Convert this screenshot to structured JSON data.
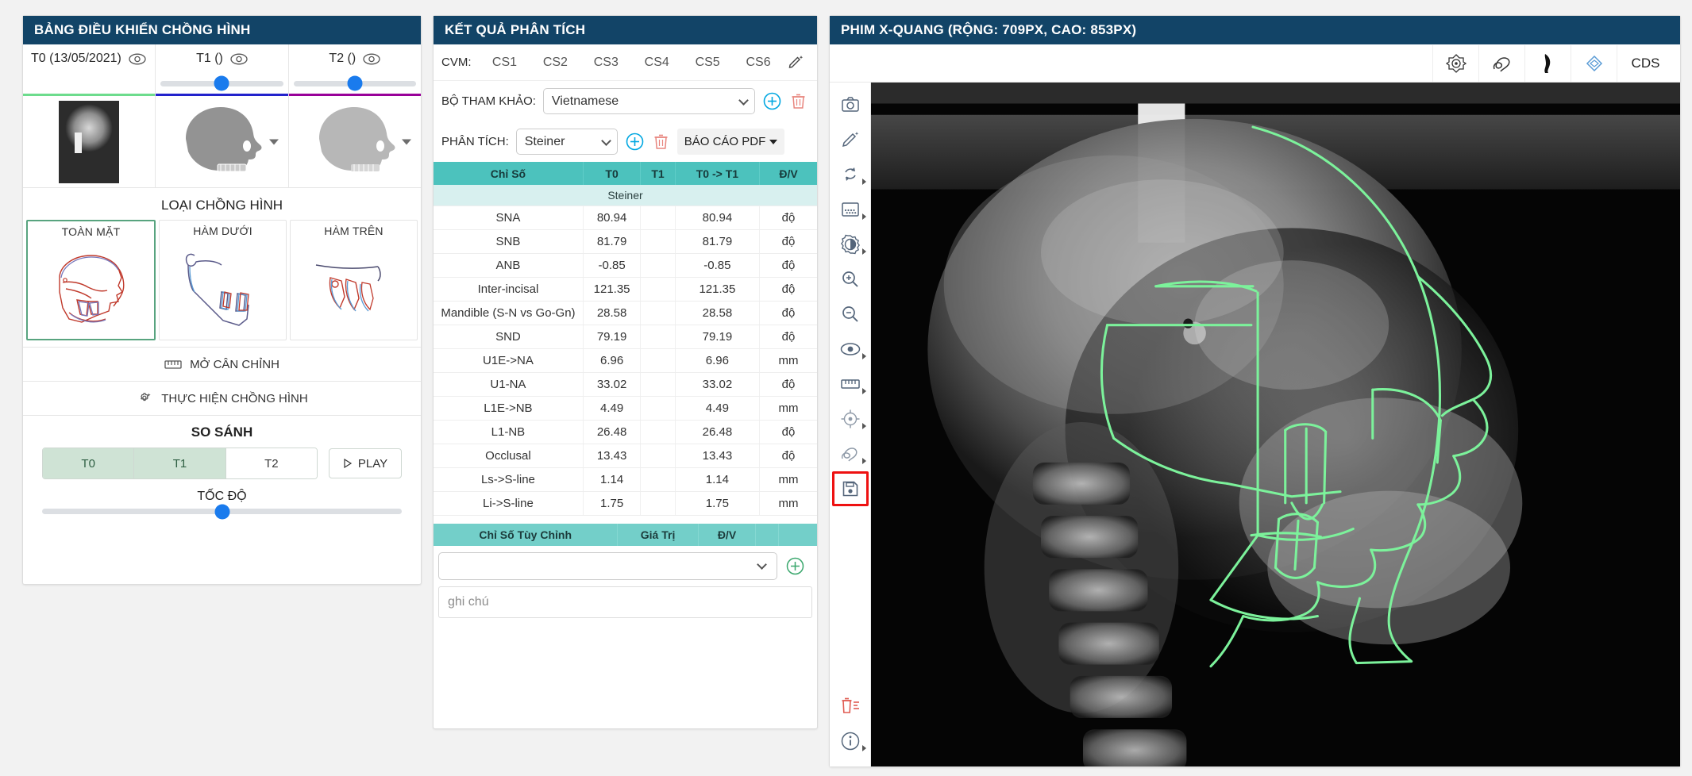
{
  "left_panel": {
    "title": "BẢNG ĐIỀU KHIỂN CHỒNG HÌNH",
    "timepoints": [
      {
        "label": "T0 (13/05/2021)",
        "accent": "#6ddc8d",
        "has_slider": false,
        "slider_pct": 0
      },
      {
        "label": "T1 ()",
        "accent": "#2222cc",
        "has_slider": true,
        "slider_pct": 50
      },
      {
        "label": "T2 ()",
        "accent": "#990099",
        "has_slider": true,
        "slider_pct": 50
      }
    ],
    "overlay_type_label": "LOẠI CHỒNG HÌNH",
    "overlay_types": [
      {
        "label": "TOÀN MẶT",
        "selected": true
      },
      {
        "label": "HÀM DƯỚI",
        "selected": false
      },
      {
        "label": "HÀM TRÊN",
        "selected": false
      }
    ],
    "open_calibration": "MỞ CÂN CHỈNH",
    "run_superimposition": "THỰC HIỆN CHỒNG HÌNH",
    "compare_title": "SO SÁNH",
    "compare_buttons": [
      {
        "label": "T0",
        "active": true
      },
      {
        "label": "T1",
        "active": true
      },
      {
        "label": "T2",
        "active": false
      }
    ],
    "play_label": "PLAY",
    "speed_label": "TỐC ĐỘ",
    "speed_pct": 50
  },
  "mid_panel": {
    "title": "KẾT QUẢ PHÂN TÍCH",
    "cvm_label": "CVM:",
    "cvm_stages": [
      "CS1",
      "CS2",
      "CS3",
      "CS4",
      "CS5",
      "CS6"
    ],
    "reference_label": "BỘ THAM KHẢO:",
    "reference_value": "Vietnamese",
    "analysis_label": "PHÂN TÍCH:",
    "analysis_value": "Steiner",
    "pdf_button": "BÁO CÁO PDF",
    "table": {
      "headers": [
        "Chỉ Số",
        "T0",
        "T1",
        "T0 -> T1",
        "Đ/V"
      ],
      "group_label": "Steiner",
      "rows": [
        {
          "name": "SNA",
          "t0": "80.94",
          "t0_color": "blue",
          "t1": "",
          "delta": "80.94",
          "unit": "độ"
        },
        {
          "name": "SNB",
          "t0": "81.79",
          "t0_color": "normal",
          "t1": "",
          "delta": "81.79",
          "unit": "độ"
        },
        {
          "name": "ANB",
          "t0": "-0.85",
          "t0_color": "blue",
          "t1": "",
          "delta": "-0.85",
          "unit": "độ"
        },
        {
          "name": "Inter-incisal",
          "t0": "121.35",
          "t0_color": "normal",
          "t1": "",
          "delta": "121.35",
          "unit": "độ"
        },
        {
          "name": "Mandible (S-N vs Go-Gn)",
          "t0": "28.58",
          "t0_color": "normal",
          "t1": "",
          "delta": "28.58",
          "unit": "độ"
        },
        {
          "name": "SND",
          "t0": "79.19",
          "t0_color": "normal",
          "t1": "",
          "delta": "79.19",
          "unit": "độ"
        },
        {
          "name": "U1E->NA",
          "t0": "6.96",
          "t0_color": "red",
          "t1": "",
          "delta": "6.96",
          "unit": "mm"
        },
        {
          "name": "U1-NA",
          "t0": "33.02",
          "t0_color": "red",
          "t1": "",
          "delta": "33.02",
          "unit": "độ"
        },
        {
          "name": "L1E->NB",
          "t0": "4.49",
          "t0_color": "normal",
          "t1": "",
          "delta": "4.49",
          "unit": "mm"
        },
        {
          "name": "L1-NB",
          "t0": "26.48",
          "t0_color": "normal",
          "t1": "",
          "delta": "26.48",
          "unit": "độ"
        },
        {
          "name": "Occlusal",
          "t0": "13.43",
          "t0_color": "normal",
          "t1": "",
          "delta": "13.43",
          "unit": "độ"
        },
        {
          "name": "Ls->S-line",
          "t0": "1.14",
          "t0_color": "normal",
          "t1": "",
          "delta": "1.14",
          "unit": "mm"
        },
        {
          "name": "Li->S-line",
          "t0": "1.75",
          "t0_color": "normal",
          "t1": "",
          "delta": "1.75",
          "unit": "mm"
        }
      ]
    },
    "custom_table": {
      "headers": [
        "Chỉ Số Tùy Chỉnh",
        "Giá Trị",
        "Đ/V",
        "",
        ""
      ],
      "select_value": ""
    },
    "note_placeholder": "ghi chú"
  },
  "right_panel": {
    "title": "PHIM X-QUANG (RỘNG: 709PX, CAO: 853PX)",
    "top_tools": [
      {
        "name": "target-icon",
        "label": ""
      },
      {
        "name": "curve-trace-icon",
        "label": ""
      },
      {
        "name": "profile-shape-icon",
        "label": ""
      },
      {
        "name": "layers-icon",
        "label": ""
      },
      {
        "name": "cds-label",
        "label": "CDS"
      }
    ],
    "side_tools": [
      {
        "name": "camera-icon",
        "caret": false,
        "selected": false,
        "danger": false
      },
      {
        "name": "pencil-add-icon",
        "caret": false,
        "selected": false,
        "danger": false
      },
      {
        "name": "rotate-icon",
        "caret": true,
        "selected": false,
        "danger": false
      },
      {
        "name": "filter-grid-icon",
        "caret": true,
        "selected": false,
        "danger": false
      },
      {
        "name": "brightness-contrast-icon",
        "caret": true,
        "selected": false,
        "danger": false
      },
      {
        "name": "zoom-in-icon",
        "caret": false,
        "selected": false,
        "danger": false
      },
      {
        "name": "zoom-out-icon",
        "caret": false,
        "selected": false,
        "danger": false
      },
      {
        "name": "eye-icon",
        "caret": true,
        "selected": false,
        "danger": false
      },
      {
        "name": "ruler-icon",
        "caret": true,
        "selected": false,
        "danger": false
      },
      {
        "name": "crosshair-icon",
        "caret": true,
        "selected": false,
        "danger": false
      },
      {
        "name": "curve-trace-icon",
        "caret": true,
        "selected": false,
        "danger": false
      },
      {
        "name": "save-icon",
        "caret": false,
        "selected": true,
        "danger": false
      }
    ],
    "side_tools_bottom": [
      {
        "name": "delete-list-icon",
        "caret": false,
        "selected": false,
        "danger": true
      },
      {
        "name": "info-icon",
        "caret": true,
        "selected": false,
        "danger": false
      }
    ]
  },
  "colors": {
    "panel_header": "#124467",
    "table_header": "#4cc2bd",
    "group_row": "#d8f0ef",
    "accent_blue": "#1a7bed",
    "trace_green": "#7cf29b",
    "selected_green": "#58a47f",
    "selection_red": "#ee1111"
  }
}
